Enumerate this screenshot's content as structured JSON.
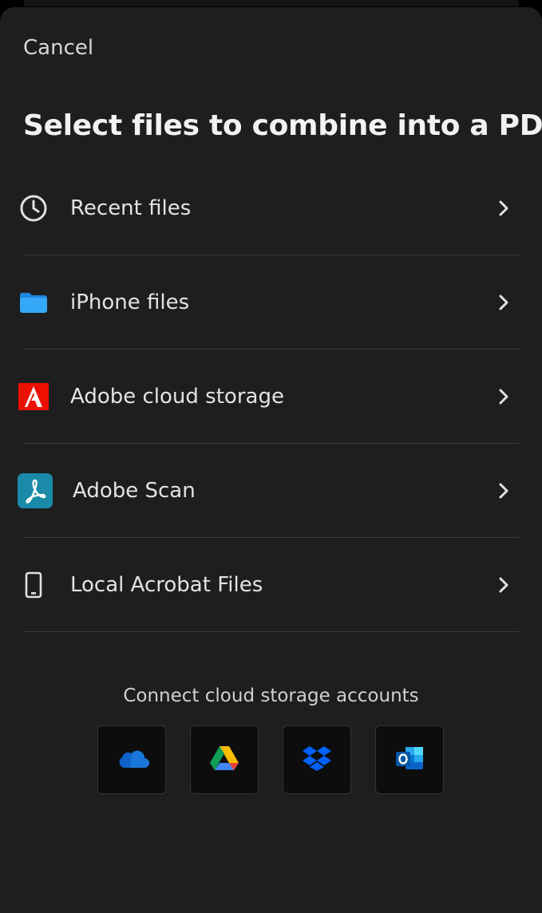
{
  "header": {
    "cancel_label": "Cancel",
    "title": "Select files to combine into a PDF"
  },
  "sources": [
    {
      "label": "Recent files",
      "icon": "clock-icon"
    },
    {
      "label": "iPhone files",
      "icon": "folder-icon"
    },
    {
      "label": "Adobe cloud storage",
      "icon": "adobe-logo-icon"
    },
    {
      "label": "Adobe Scan",
      "icon": "adobe-scan-icon"
    },
    {
      "label": "Local Acrobat Files",
      "icon": "phone-icon"
    }
  ],
  "cloud_accounts": {
    "heading": "Connect cloud storage accounts",
    "services": [
      {
        "icon": "onedrive-icon"
      },
      {
        "icon": "google-drive-icon"
      },
      {
        "icon": "dropbox-icon"
      },
      {
        "icon": "outlook-icon"
      }
    ]
  },
  "colors": {
    "sheet_background": "#1e1e1f",
    "adobe_red": "#eb1000",
    "adobe_scan_teal": "#1a8aa8",
    "folder_blue": "#2a9df4",
    "onedrive_blue": "#0f62c9",
    "dropbox_blue": "#0061fe",
    "outlook_blue": "#0a64c8"
  }
}
